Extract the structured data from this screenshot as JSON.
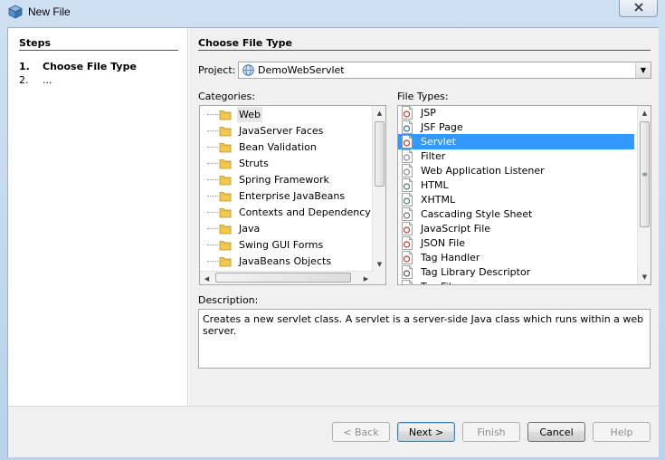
{
  "window": {
    "title": "New File"
  },
  "steps": {
    "heading": "Steps",
    "items": [
      {
        "num": "1.",
        "label": "Choose File Type"
      },
      {
        "num": "2.",
        "label": "..."
      }
    ]
  },
  "panel": {
    "heading": "Choose File Type",
    "project_label": "Project:",
    "project_value": "DemoWebServlet",
    "categories_label": "Categories:",
    "file_types_label": "File Types:",
    "description_label": "Description:",
    "description_text": "Creates a new servlet class. A servlet is a server-side Java class which runs within a web server."
  },
  "categories": [
    {
      "label": "Web",
      "selected": true
    },
    {
      "label": "JavaServer Faces"
    },
    {
      "label": "Bean Validation"
    },
    {
      "label": "Struts"
    },
    {
      "label": "Spring Framework"
    },
    {
      "label": "Enterprise JavaBeans"
    },
    {
      "label": "Contexts and Dependency Inje"
    },
    {
      "label": "Java"
    },
    {
      "label": "Swing GUI Forms"
    },
    {
      "label": "JavaBeans Objects"
    }
  ],
  "file_types": [
    {
      "label": "JSP",
      "icon": "jsp-file-icon"
    },
    {
      "label": "JSF Page",
      "icon": "jsf-page-icon"
    },
    {
      "label": "Servlet",
      "icon": "servlet-icon",
      "selected": true
    },
    {
      "label": "Filter",
      "icon": "filter-icon"
    },
    {
      "label": "Web Application Listener",
      "icon": "listener-icon"
    },
    {
      "label": "HTML",
      "icon": "html-file-icon"
    },
    {
      "label": "XHTML",
      "icon": "xhtml-file-icon"
    },
    {
      "label": "Cascading Style Sheet",
      "icon": "css-file-icon"
    },
    {
      "label": "JavaScript File",
      "icon": "javascript-file-icon"
    },
    {
      "label": "JSON File",
      "icon": "json-file-icon"
    },
    {
      "label": "Tag Handler",
      "icon": "tag-handler-icon"
    },
    {
      "label": "Tag Library Descriptor",
      "icon": "tld-icon"
    },
    {
      "label": "Tag File",
      "icon": "tag-file-icon"
    }
  ],
  "buttons": {
    "back": "< Back",
    "next": "Next >",
    "finish": "Finish",
    "cancel": "Cancel",
    "help": "Help"
  },
  "colors": {
    "selection": "#3399ff",
    "folder": "#f2c94c"
  }
}
